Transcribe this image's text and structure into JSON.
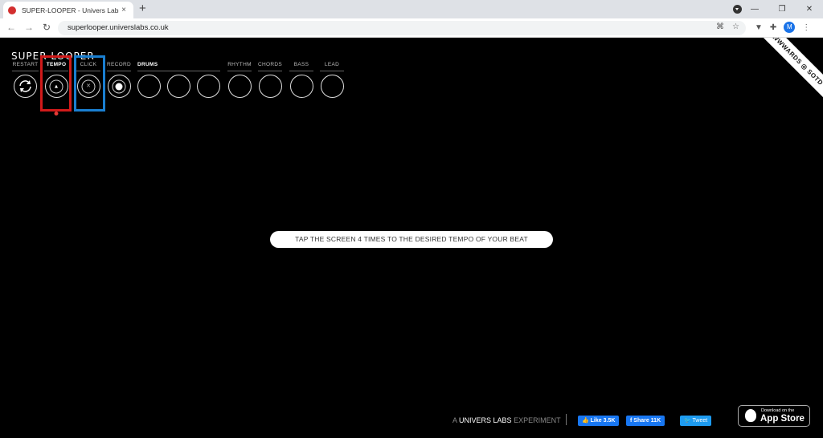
{
  "browser": {
    "tab_title": "SUPER-LOOPER - Univers Labs",
    "tab_close": "×",
    "new_tab": "+",
    "url": "superlooper.universlabs.co.uk",
    "profile_initial": "M",
    "window_controls": [
      "—",
      "❐",
      "✕"
    ]
  },
  "app": {
    "logo": "SUPER LOOPER",
    "controls": [
      {
        "label": "RESTART"
      },
      {
        "label": "TEMPO"
      },
      {
        "label": "CLICK"
      },
      {
        "label": "RECORD"
      }
    ],
    "drums_label": "DRUMS",
    "instruments": [
      {
        "label": "RHYTHM"
      },
      {
        "label": "CHORDS"
      },
      {
        "label": "BASS"
      },
      {
        "label": "LEAD"
      }
    ],
    "prompt": "TAP THE SCREEN 4 TIMES TO THE DESIRED TEMPO OF YOUR BEAT",
    "awwwards": "AWWWARDS ◎ SOTD",
    "footer": {
      "credit_prefix": "A",
      "credit_brand": "UNIVERS LABS",
      "credit_suffix": "EXPERIMENT"
    },
    "social": {
      "like": "👍 Like 3.5K",
      "share": "f Share 11K",
      "tweet": "🐦 Tweet"
    },
    "appstore": {
      "small": "Download on the",
      "big": "App Store"
    }
  },
  "colors": {
    "highlight_tempo": "#d11a1a",
    "highlight_click": "#1a7fd1",
    "tempo_indicator": "#e53935"
  }
}
